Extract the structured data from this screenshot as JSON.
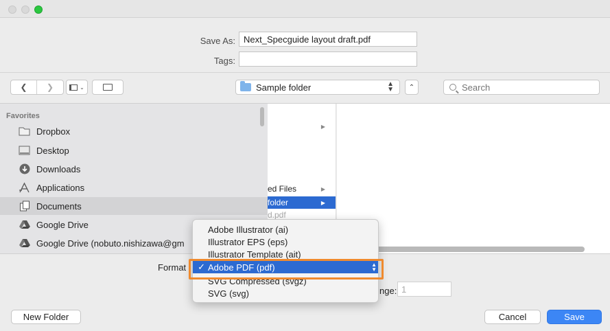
{
  "window": {
    "save_as_label": "Save As:",
    "save_as_value": "Next_Specguide layout draft.pdf",
    "tags_label": "Tags:",
    "tags_value": ""
  },
  "toolbar": {
    "location": "Sample folder",
    "search_placeholder": "Search"
  },
  "sidebar": {
    "heading": "Favorites",
    "items": [
      {
        "label": "Dropbox",
        "icon": "folder-icon"
      },
      {
        "label": "Desktop",
        "icon": "desktop-icon"
      },
      {
        "label": "Downloads",
        "icon": "downloads-icon"
      },
      {
        "label": "Applications",
        "icon": "applications-icon"
      },
      {
        "label": "Documents",
        "icon": "documents-icon"
      },
      {
        "label": "Google Drive",
        "icon": "google-drive-icon"
      },
      {
        "label": "Google Drive (nobuto.nishizawa@gm",
        "icon": "google-drive-icon"
      }
    ]
  },
  "browser": {
    "column1": [
      {
        "label": "ed Files"
      },
      {
        "label": "folder"
      },
      {
        "label": "d.pdf"
      }
    ]
  },
  "options": {
    "format_label": "Format",
    "range_label": "nge:",
    "range_value": "1"
  },
  "format_menu": {
    "items": [
      {
        "label": "Adobe Illustrator (ai)",
        "checked": ""
      },
      {
        "label": "Illustrator EPS (eps)",
        "checked": ""
      },
      {
        "label": "Illustrator Template (ait)",
        "checked": ""
      },
      {
        "label": "Adobe PDF (pdf)",
        "checked": "✓"
      },
      {
        "label": "SVG Compressed (svgz)",
        "checked": ""
      },
      {
        "label": "SVG (svg)",
        "checked": ""
      }
    ]
  },
  "buttons": {
    "new_folder": "New Folder",
    "cancel": "Cancel",
    "save": "Save"
  },
  "colors": {
    "accent": "#3c86f5",
    "selection": "#2c6ad1",
    "highlight": "#ef8a2e"
  }
}
